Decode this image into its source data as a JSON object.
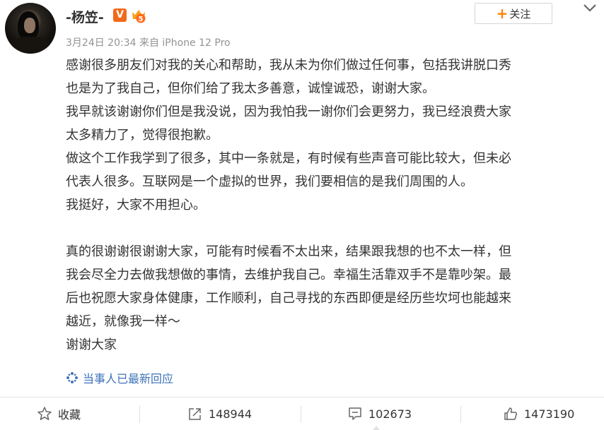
{
  "colors": {
    "brand_orange": "#ff8200",
    "link_blue": "#3e72b8",
    "meta_gray": "#939393",
    "text": "#333333"
  },
  "post": {
    "author": "-杨笠-",
    "verified_badge": "V",
    "member_badge_level": "5",
    "meta": "3月24日 20:34 来自 iPhone 12 Pro",
    "follow_label": "关注",
    "content_lines": [
      "感谢很多朋友们对我的关心和帮助，我从未为你们做过任何事，包括我讲脱口秀",
      "也是为了我自己，但你们给了我太多善意，诚惶诚恐，谢谢大家。",
      "我早就该谢谢你们但是我没说，因为我怕我一谢你们会更努力，我已经浪费大家",
      "太多精力了，觉得很抱歉。",
      "做这个工作我学到了很多，其中一条就是，有时候有些声音可能比较大，但未必",
      "代表人很多。互联网是一个虚拟的世界，我们要相信的是我们周围的人。",
      "我挺好，大家不用担心。",
      "",
      "真的很谢谢很谢谢大家，可能有时候看不太出来，结果跟我想的也不太一样，但",
      "我会尽全力去做我想做的事情，去维护我自己。幸福生活靠双手不是靠吵架。最",
      "后也祝愿大家身体健康，工作顺利，自己寻找的东西即便是经历些坎坷也能越来",
      "越近，就像我一样～",
      "谢谢大家"
    ],
    "reply_link": "当事人已最新回应"
  },
  "actions": {
    "favorite": {
      "label": "收藏",
      "icon": "star-icon"
    },
    "repost": {
      "count": "148944",
      "icon": "repost-icon"
    },
    "comment": {
      "count": "102673",
      "icon": "comment-icon"
    },
    "like": {
      "count": "1473190",
      "icon": "thumbs-up-icon"
    }
  }
}
